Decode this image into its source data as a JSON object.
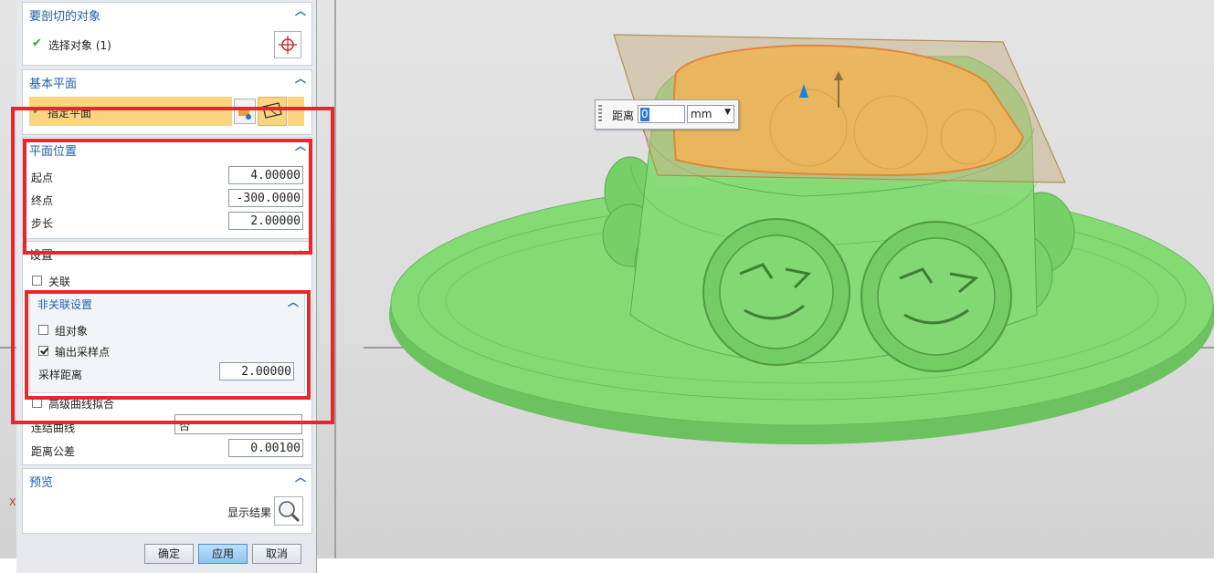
{
  "sections": {
    "objects": {
      "title": "要剖切的对象",
      "select_label": "选择对象 (1)"
    },
    "base_plane": {
      "title": "基本平面",
      "specify_label": "指定平面"
    },
    "plane_position": {
      "title": "平面位置",
      "start_label": "起点",
      "start_value": "4.00000",
      "end_label": "终点",
      "end_value": "-300.0000",
      "step_label": "步长",
      "step_value": "2.00000"
    },
    "settings": {
      "title": "设置",
      "associative_label": "关联",
      "associative_checked": false
    },
    "non_assoc": {
      "title": "非关联设置",
      "group_objects_label": "组对象",
      "group_objects_checked": false,
      "output_points_label": "输出采样点",
      "output_points_checked": true,
      "sample_distance_label": "采样距离",
      "sample_distance_value": "2.00000"
    },
    "advanced": {
      "advanced_fit_label": "高级曲线拟合",
      "connect_curves_label": "连结曲线",
      "connect_curves_value": "否",
      "distance_tol_label": "距离公差",
      "distance_tol_value": "0.00100"
    },
    "preview": {
      "title": "预览",
      "show_result_label": "显示结果"
    }
  },
  "buttons": {
    "ok": "确定",
    "apply": "应用",
    "cancel": "取消"
  },
  "distance_popup": {
    "label": "距离",
    "value": "0",
    "unit": "mm"
  },
  "axis_label": "X",
  "colors": {
    "model_green": "#7ed66e",
    "cut_plane_orange": "#efb45a",
    "highlight_red": "#e8262c",
    "title_blue": "#1e5ea8"
  }
}
